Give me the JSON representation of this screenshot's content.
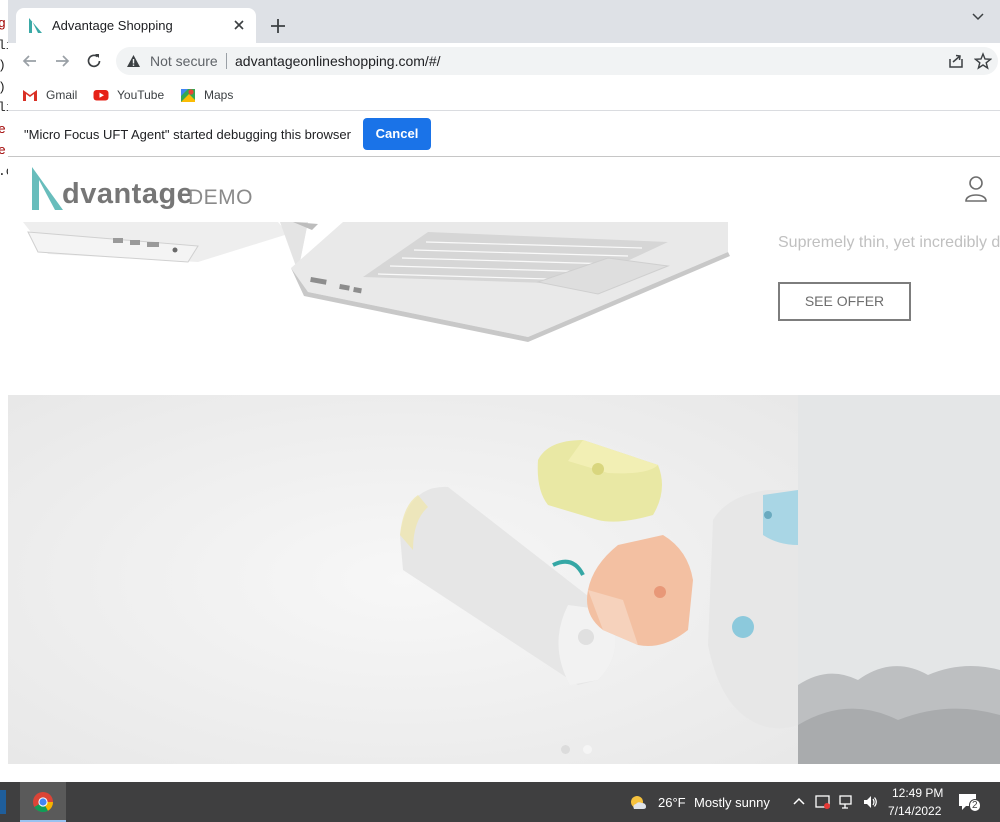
{
  "background_fragments": [
    "g",
    "li",
    ").",
    ").",
    "li",
    "e",
    "e",
    ".c"
  ],
  "tab": {
    "title": "Advantage Shopping",
    "favicon": "advantage-logo-icon"
  },
  "toolbar": {
    "security_label": "Not secure",
    "url": "advantageonlineshopping.com/#/"
  },
  "bookmarks": [
    {
      "label": "Gmail",
      "icon": "gmail-icon"
    },
    {
      "label": "YouTube",
      "icon": "youtube-icon"
    },
    {
      "label": "Maps",
      "icon": "maps-icon"
    }
  ],
  "infobar": {
    "message": "\"Micro Focus UFT Agent\" started debugging this browser",
    "cancel_label": "Cancel"
  },
  "site": {
    "logo_word": "dvantage",
    "logo_demo": "DEMO",
    "hero_tagline": "Supremely thin, yet incredibly d",
    "see_offer_label": "SEE OFFER",
    "carousel_dots": 2,
    "accent_color": "#35a7a5"
  },
  "taskbar": {
    "temperature": "26°F",
    "weather": "Mostly sunny",
    "time": "12:49 PM",
    "date": "7/14/2022",
    "notifications_count": "2"
  },
  "colors": {
    "tabstrip": "#dee1e6",
    "button_blue": "#1a73e8",
    "taskbar": "#3f3f40"
  }
}
